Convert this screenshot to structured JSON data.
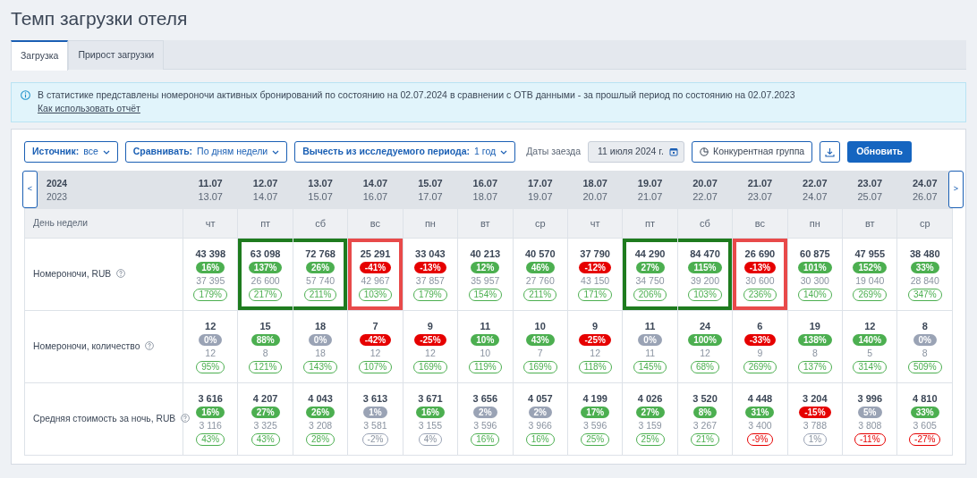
{
  "title": "Темп загрузки отеля",
  "tabs": [
    {
      "label": "Загрузка",
      "selected": true
    },
    {
      "label": "Прирост загрузки",
      "selected": false
    }
  ],
  "info": {
    "text": "В статистике представлены номероночи активных бронирований по состоянию на 02.07.2024 в сравнении с ОТВ данными - за прошлый период по состоянию на 02.07.2023",
    "link": "Как использовать отчёт"
  },
  "toolbar": {
    "filters": [
      {
        "label": "Источник:",
        "value": "все"
      },
      {
        "label": "Сравнивать:",
        "value": "По дням недели"
      },
      {
        "label": "Вычесть из исследуемого периода:",
        "value": "1 год"
      }
    ],
    "dates_label": "Даты заезда",
    "date_value": "11 июля 2024 г.",
    "competitors_button": "Конкурентная группа",
    "refresh_button": "Обновить"
  },
  "table": {
    "prev_button": "<",
    "next_button": ">",
    "year_current": "2024",
    "year_previous": "2023",
    "weekday_label": "День недели",
    "columns": [
      {
        "date": "11.07",
        "date_prev": "13.07",
        "weekday": "чт"
      },
      {
        "date": "12.07",
        "date_prev": "14.07",
        "weekday": "пт"
      },
      {
        "date": "13.07",
        "date_prev": "15.07",
        "weekday": "сб"
      },
      {
        "date": "14.07",
        "date_prev": "16.07",
        "weekday": "вс"
      },
      {
        "date": "15.07",
        "date_prev": "17.07",
        "weekday": "пн"
      },
      {
        "date": "16.07",
        "date_prev": "18.07",
        "weekday": "вт"
      },
      {
        "date": "17.07",
        "date_prev": "19.07",
        "weekday": "ср"
      },
      {
        "date": "18.07",
        "date_prev": "20.07",
        "weekday": "чт"
      },
      {
        "date": "19.07",
        "date_prev": "21.07",
        "weekday": "пт"
      },
      {
        "date": "20.07",
        "date_prev": "22.07",
        "weekday": "сб"
      },
      {
        "date": "21.07",
        "date_prev": "23.07",
        "weekday": "вс"
      },
      {
        "date": "22.07",
        "date_prev": "24.07",
        "weekday": "пн"
      },
      {
        "date": "23.07",
        "date_prev": "25.07",
        "weekday": "вт"
      },
      {
        "date": "24.07",
        "date_prev": "26.07",
        "weekday": "ср"
      }
    ],
    "rows": [
      {
        "label": "Номероночи, RUB",
        "cells": [
          {
            "value": "43 398",
            "change": {
              "text": "16%",
              "kind": "up"
            },
            "prev": "37 395",
            "ratio": {
              "text": "179%",
              "kind": "up"
            }
          },
          {
            "value": "63 098",
            "change": {
              "text": "137%",
              "kind": "up"
            },
            "prev": "26 600",
            "ratio": {
              "text": "217%",
              "kind": "up"
            },
            "color": "#1e7b1e"
          },
          {
            "value": "72 768",
            "change": {
              "text": "26%",
              "kind": "up"
            },
            "prev": "57 740",
            "ratio": {
              "text": "211%",
              "kind": "up"
            },
            "color": "#1e7b1e"
          },
          {
            "value": "25 291",
            "change": {
              "text": "-41%",
              "kind": "down"
            },
            "prev": "42 967",
            "ratio": {
              "text": "103%",
              "kind": "up"
            },
            "color": "#e84a4a"
          },
          {
            "value": "33 043",
            "change": {
              "text": "-13%",
              "kind": "down"
            },
            "prev": "37 857",
            "ratio": {
              "text": "179%",
              "kind": "up"
            }
          },
          {
            "value": "40 213",
            "change": {
              "text": "12%",
              "kind": "up"
            },
            "prev": "35 957",
            "ratio": {
              "text": "154%",
              "kind": "up"
            }
          },
          {
            "value": "40 570",
            "change": {
              "text": "46%",
              "kind": "up"
            },
            "prev": "27 760",
            "ratio": {
              "text": "211%",
              "kind": "up"
            }
          },
          {
            "value": "37 790",
            "change": {
              "text": "-12%",
              "kind": "down"
            },
            "prev": "43 150",
            "ratio": {
              "text": "171%",
              "kind": "up"
            }
          },
          {
            "value": "44 290",
            "change": {
              "text": "27%",
              "kind": "up"
            },
            "prev": "34 750",
            "ratio": {
              "text": "206%",
              "kind": "up"
            },
            "color": "#1e7b1e"
          },
          {
            "value": "84 470",
            "change": {
              "text": "115%",
              "kind": "up"
            },
            "prev": "39 200",
            "ratio": {
              "text": "103%",
              "kind": "up"
            },
            "color": "#1e7b1e"
          },
          {
            "value": "26 690",
            "change": {
              "text": "-13%",
              "kind": "down"
            },
            "prev": "30 600",
            "ratio": {
              "text": "236%",
              "kind": "up"
            },
            "color": "#e84a4a"
          },
          {
            "value": "60 875",
            "change": {
              "text": "101%",
              "kind": "up"
            },
            "prev": "30 300",
            "ratio": {
              "text": "140%",
              "kind": "up"
            }
          },
          {
            "value": "47 955",
            "change": {
              "text": "152%",
              "kind": "up"
            },
            "prev": "19 040",
            "ratio": {
              "text": "269%",
              "kind": "up"
            }
          },
          {
            "value": "38 480",
            "change": {
              "text": "33%",
              "kind": "up"
            },
            "prev": "28 840",
            "ratio": {
              "text": "347%",
              "kind": "up"
            }
          }
        ]
      },
      {
        "label": "Номероночи, количество",
        "cells": [
          {
            "value": "12",
            "change": {
              "text": "0%",
              "kind": "flat"
            },
            "prev": "12",
            "ratio": {
              "text": "95%",
              "kind": "up"
            }
          },
          {
            "value": "15",
            "change": {
              "text": "88%",
              "kind": "up"
            },
            "prev": "8",
            "ratio": {
              "text": "121%",
              "kind": "up"
            }
          },
          {
            "value": "18",
            "change": {
              "text": "0%",
              "kind": "flat"
            },
            "prev": "18",
            "ratio": {
              "text": "143%",
              "kind": "up"
            }
          },
          {
            "value": "7",
            "change": {
              "text": "-42%",
              "kind": "down"
            },
            "prev": "12",
            "ratio": {
              "text": "107%",
              "kind": "up"
            }
          },
          {
            "value": "9",
            "change": {
              "text": "-25%",
              "kind": "down"
            },
            "prev": "12",
            "ratio": {
              "text": "169%",
              "kind": "up"
            }
          },
          {
            "value": "11",
            "change": {
              "text": "10%",
              "kind": "up"
            },
            "prev": "10",
            "ratio": {
              "text": "119%",
              "kind": "up"
            }
          },
          {
            "value": "10",
            "change": {
              "text": "43%",
              "kind": "up"
            },
            "prev": "7",
            "ratio": {
              "text": "169%",
              "kind": "up"
            }
          },
          {
            "value": "9",
            "change": {
              "text": "-25%",
              "kind": "down"
            },
            "prev": "12",
            "ratio": {
              "text": "118%",
              "kind": "up"
            }
          },
          {
            "value": "11",
            "change": {
              "text": "0%",
              "kind": "flat"
            },
            "prev": "11",
            "ratio": {
              "text": "145%",
              "kind": "up"
            }
          },
          {
            "value": "24",
            "change": {
              "text": "100%",
              "kind": "up"
            },
            "prev": "12",
            "ratio": {
              "text": "68%",
              "kind": "up"
            }
          },
          {
            "value": "6",
            "change": {
              "text": "-33%",
              "kind": "down"
            },
            "prev": "9",
            "ratio": {
              "text": "269%",
              "kind": "up"
            }
          },
          {
            "value": "19",
            "change": {
              "text": "138%",
              "kind": "up"
            },
            "prev": "8",
            "ratio": {
              "text": "137%",
              "kind": "up"
            }
          },
          {
            "value": "12",
            "change": {
              "text": "140%",
              "kind": "up"
            },
            "prev": "5",
            "ratio": {
              "text": "314%",
              "kind": "up"
            }
          },
          {
            "value": "8",
            "change": {
              "text": "0%",
              "kind": "flat"
            },
            "prev": "8",
            "ratio": {
              "text": "509%",
              "kind": "up"
            }
          }
        ]
      },
      {
        "label": "Средняя стоимость за ночь, RUB",
        "cells": [
          {
            "value": "3 616",
            "change": {
              "text": "16%",
              "kind": "up"
            },
            "prev": "3 116",
            "ratio": {
              "text": "43%",
              "kind": "up"
            }
          },
          {
            "value": "4 207",
            "change": {
              "text": "27%",
              "kind": "up"
            },
            "prev": "3 325",
            "ratio": {
              "text": "43%",
              "kind": "up"
            }
          },
          {
            "value": "4 043",
            "change": {
              "text": "26%",
              "kind": "up"
            },
            "prev": "3 208",
            "ratio": {
              "text": "28%",
              "kind": "up"
            }
          },
          {
            "value": "3 613",
            "change": {
              "text": "1%",
              "kind": "flat"
            },
            "prev": "3 581",
            "ratio": {
              "text": "-2%",
              "kind": "flat"
            }
          },
          {
            "value": "3 671",
            "change": {
              "text": "16%",
              "kind": "up"
            },
            "prev": "3 155",
            "ratio": {
              "text": "4%",
              "kind": "flat"
            }
          },
          {
            "value": "3 656",
            "change": {
              "text": "2%",
              "kind": "flat"
            },
            "prev": "3 596",
            "ratio": {
              "text": "16%",
              "kind": "up"
            }
          },
          {
            "value": "4 057",
            "change": {
              "text": "2%",
              "kind": "flat"
            },
            "prev": "3 966",
            "ratio": {
              "text": "16%",
              "kind": "up"
            }
          },
          {
            "value": "4 199",
            "change": {
              "text": "17%",
              "kind": "up"
            },
            "prev": "3 596",
            "ratio": {
              "text": "25%",
              "kind": "up"
            }
          },
          {
            "value": "4 026",
            "change": {
              "text": "27%",
              "kind": "up"
            },
            "prev": "3 159",
            "ratio": {
              "text": "25%",
              "kind": "up"
            }
          },
          {
            "value": "3 520",
            "change": {
              "text": "8%",
              "kind": "up"
            },
            "prev": "3 267",
            "ratio": {
              "text": "21%",
              "kind": "up"
            }
          },
          {
            "value": "4 448",
            "change": {
              "text": "31%",
              "kind": "up"
            },
            "prev": "3 400",
            "ratio": {
              "text": "-9%",
              "kind": "down"
            }
          },
          {
            "value": "3 204",
            "change": {
              "text": "-15%",
              "kind": "down"
            },
            "prev": "3 788",
            "ratio": {
              "text": "1%",
              "kind": "flat"
            }
          },
          {
            "value": "3 996",
            "change": {
              "text": "5%",
              "kind": "flat"
            },
            "prev": "3 808",
            "ratio": {
              "text": "-11%",
              "kind": "down"
            }
          },
          {
            "value": "4 810",
            "change": {
              "text": "33%",
              "kind": "up"
            },
            "prev": "3 605",
            "ratio": {
              "text": "-27%",
              "kind": "down"
            }
          }
        ]
      }
    ]
  }
}
